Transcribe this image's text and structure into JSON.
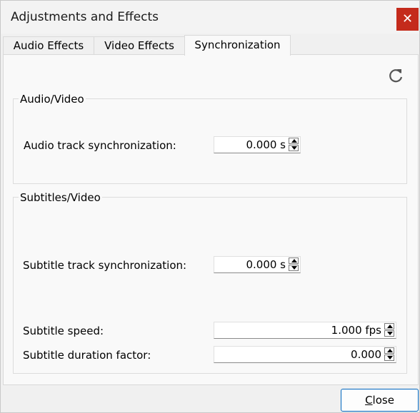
{
  "window": {
    "title": "Adjustments and Effects",
    "close_glyph": "✕"
  },
  "tabs": [
    {
      "label": "Audio Effects"
    },
    {
      "label": "Video Effects"
    },
    {
      "label": "Synchronization"
    }
  ],
  "active_tab": "Synchronization",
  "audio_video": {
    "title": "Audio/Video",
    "audio_sync_label": "Audio track synchronization:",
    "audio_sync_value": "0.000 s"
  },
  "subtitles_video": {
    "title": "Subtitles/Video",
    "subtitle_sync_label": "Subtitle track synchronization:",
    "subtitle_sync_value": "0.000 s",
    "subtitle_speed_label": "Subtitle speed:",
    "subtitle_speed_value": "1.000 fps",
    "subtitle_duration_label": "Subtitle duration factor:",
    "subtitle_duration_value": "0.000"
  },
  "footer": {
    "close_first": "C",
    "close_rest": "lose"
  },
  "icons": {
    "refresh": "refresh-icon"
  },
  "colors": {
    "close_red": "#c42b1c",
    "accent": "#0067c0"
  }
}
